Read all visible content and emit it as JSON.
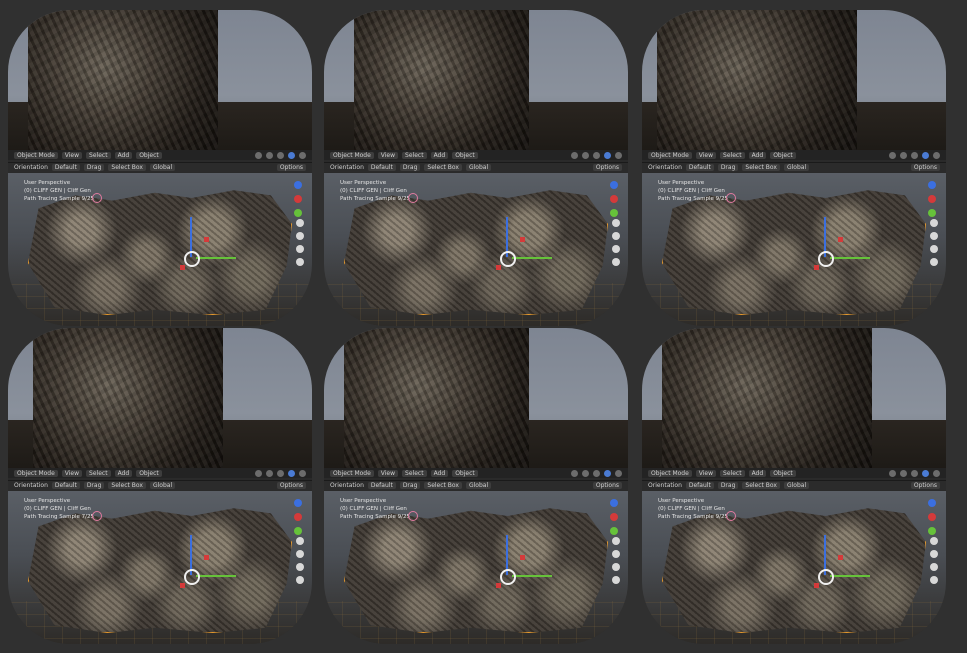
{
  "panels": [
    {
      "header1": {
        "mode": "Object Mode",
        "menu": [
          "View",
          "Select",
          "Add",
          "Object"
        ]
      },
      "header2": {
        "orientation": "Orientation",
        "default": "Default",
        "drag": "Drag",
        "select_box": "Select Box",
        "global": "Global",
        "options": "Options"
      },
      "info": [
        "User Perspective",
        "(0) CLIFF GEN | Cliff Gen",
        "Path Tracing Sample 9/25"
      ]
    },
    {
      "header1": {
        "mode": "Object Mode",
        "menu": [
          "View",
          "Select",
          "Add",
          "Object"
        ]
      },
      "header2": {
        "orientation": "Orientation",
        "default": "Default",
        "drag": "Drag",
        "select_box": "Select Box",
        "global": "Global",
        "options": "Options"
      },
      "info": [
        "User Perspective",
        "(0) CLIFF GEN | Cliff Gen",
        "Path Tracing Sample 9/25"
      ]
    },
    {
      "header1": {
        "mode": "Object Mode",
        "menu": [
          "View",
          "Select",
          "Add",
          "Object"
        ]
      },
      "header2": {
        "orientation": "Orientation",
        "default": "Default",
        "drag": "Drag",
        "select_box": "Select Box",
        "global": "Global",
        "options": "Options"
      },
      "info": [
        "User Perspective",
        "(0) CLIFF GEN | Cliff Gen",
        "Path Tracing Sample 9/25"
      ]
    },
    {
      "header1": {
        "mode": "Object Mode",
        "menu": [
          "View",
          "Select",
          "Add",
          "Object"
        ]
      },
      "header2": {
        "orientation": "Orientation",
        "default": "Default",
        "drag": "Drag",
        "select_box": "Select Box",
        "global": "Global",
        "options": "Options"
      },
      "info": [
        "User Perspective",
        "(0) CLIFF GEN | Cliff Gen",
        "Path Tracing Sample 7/25"
      ]
    },
    {
      "header1": {
        "mode": "Object Mode",
        "menu": [
          "View",
          "Select",
          "Add",
          "Object"
        ]
      },
      "header2": {
        "orientation": "Orientation",
        "default": "Default",
        "drag": "Drag",
        "select_box": "Select Box",
        "global": "Global",
        "options": "Options"
      },
      "info": [
        "User Perspective",
        "(0) CLIFF GEN | Cliff Gen",
        "Path Tracing Sample 9/25"
      ]
    },
    {
      "header1": {
        "mode": "Object Mode",
        "menu": [
          "View",
          "Select",
          "Add",
          "Object"
        ]
      },
      "header2": {
        "orientation": "Orientation",
        "default": "Default",
        "drag": "Drag",
        "select_box": "Select Box",
        "global": "Global",
        "options": "Options"
      },
      "info": [
        "User Perspective",
        "(0) CLIFF GEN | Cliff Gen",
        "Path Tracing Sample 9/25"
      ]
    }
  ],
  "colors": {
    "selection_outline": "#e89a2c",
    "axis_z": "#3b6fe0",
    "axis_x": "#66c23a",
    "axis_y_handle": "#d43a3a",
    "background": "#303030"
  },
  "icons": [
    "move-tool-icon",
    "rotate-tool-icon",
    "zoom-icon",
    "hand-pan-icon",
    "camera-icon",
    "grid-view-icon",
    "navigation-gizmo-icon"
  ]
}
